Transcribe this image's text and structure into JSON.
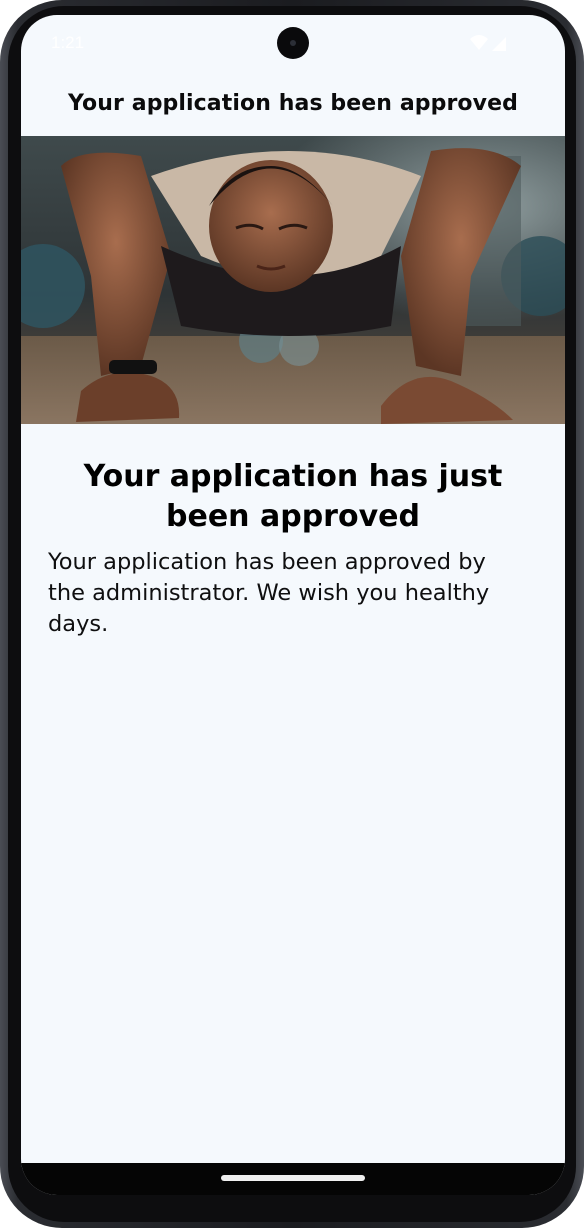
{
  "status_bar": {
    "time": "1:21",
    "icons": [
      "wifi-icon",
      "signal-icon"
    ]
  },
  "app_bar": {
    "title": "Your application has been approved"
  },
  "hero_image": {
    "icon": "woman-doing-pushups-photo"
  },
  "content": {
    "headline": "Your application has just been approved",
    "body": "Your application has been approved by the administrator. We wish you healthy days."
  },
  "colors": {
    "screen_background": "#f5f9fd",
    "text": "#000000",
    "nav_bar": "#050505"
  }
}
